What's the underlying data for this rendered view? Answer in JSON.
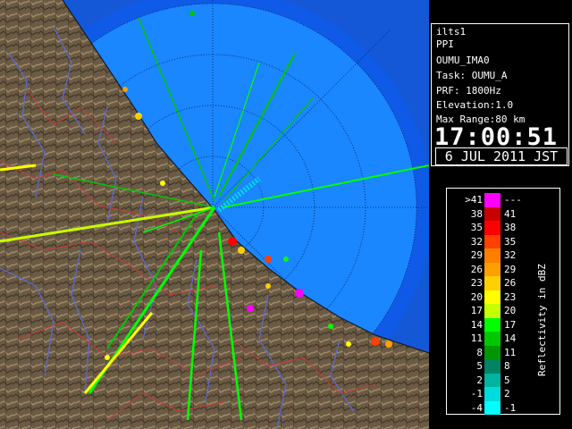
{
  "radar_image": {
    "description_icon": "radar-ppi-map",
    "colors": {
      "ocean_inner": "#1a82ff",
      "ocean_outer": "#0a48e0",
      "ocean_far": "#1458d8",
      "land": "#6b5b45",
      "land_light": "#9c8a66",
      "river": "#5a6cd6",
      "boundary": "#c83c3c",
      "range_ring": "#0b1c50"
    }
  },
  "info": {
    "radar_name": "ilts1",
    "product": "PPI",
    "site": "OUMU_IMA0",
    "task": "Task: OUMU_A",
    "prf": "PRF: 1800Hz",
    "elevation": "Elevation:1.0",
    "max_range": "Max Range:80 km",
    "time": "17:00:51",
    "date": "6 JUL 2011 JST"
  },
  "legend": {
    "title": "Reflectivity in dBZ",
    "rows": [
      {
        "lo": ">41",
        "hi": "---",
        "color": "#ff00ff"
      },
      {
        "lo": "38",
        "hi": "41",
        "color": "#c80000"
      },
      {
        "lo": "35",
        "hi": "38",
        "color": "#ff0000"
      },
      {
        "lo": "32",
        "hi": "35",
        "color": "#ff4000"
      },
      {
        "lo": "29",
        "hi": "32",
        "color": "#ff8000"
      },
      {
        "lo": "26",
        "hi": "29",
        "color": "#ffa000"
      },
      {
        "lo": "23",
        "hi": "26",
        "color": "#ffd000"
      },
      {
        "lo": "20",
        "hi": "23",
        "color": "#ffff00"
      },
      {
        "lo": "17",
        "hi": "20",
        "color": "#c8ff00"
      },
      {
        "lo": "14",
        "hi": "17",
        "color": "#00ff00"
      },
      {
        "lo": "11",
        "hi": "14",
        "color": "#00c800"
      },
      {
        "lo": "8",
        "hi": "11",
        "color": "#009600"
      },
      {
        "lo": "5",
        "hi": "8",
        "color": "#008264"
      },
      {
        "lo": "2",
        "hi": "5",
        "color": "#00b4a0"
      },
      {
        "lo": "-1",
        "hi": "2",
        "color": "#00dcdc"
      },
      {
        "lo": "-4",
        "hi": "-1",
        "color": "#00ffff"
      }
    ]
  }
}
